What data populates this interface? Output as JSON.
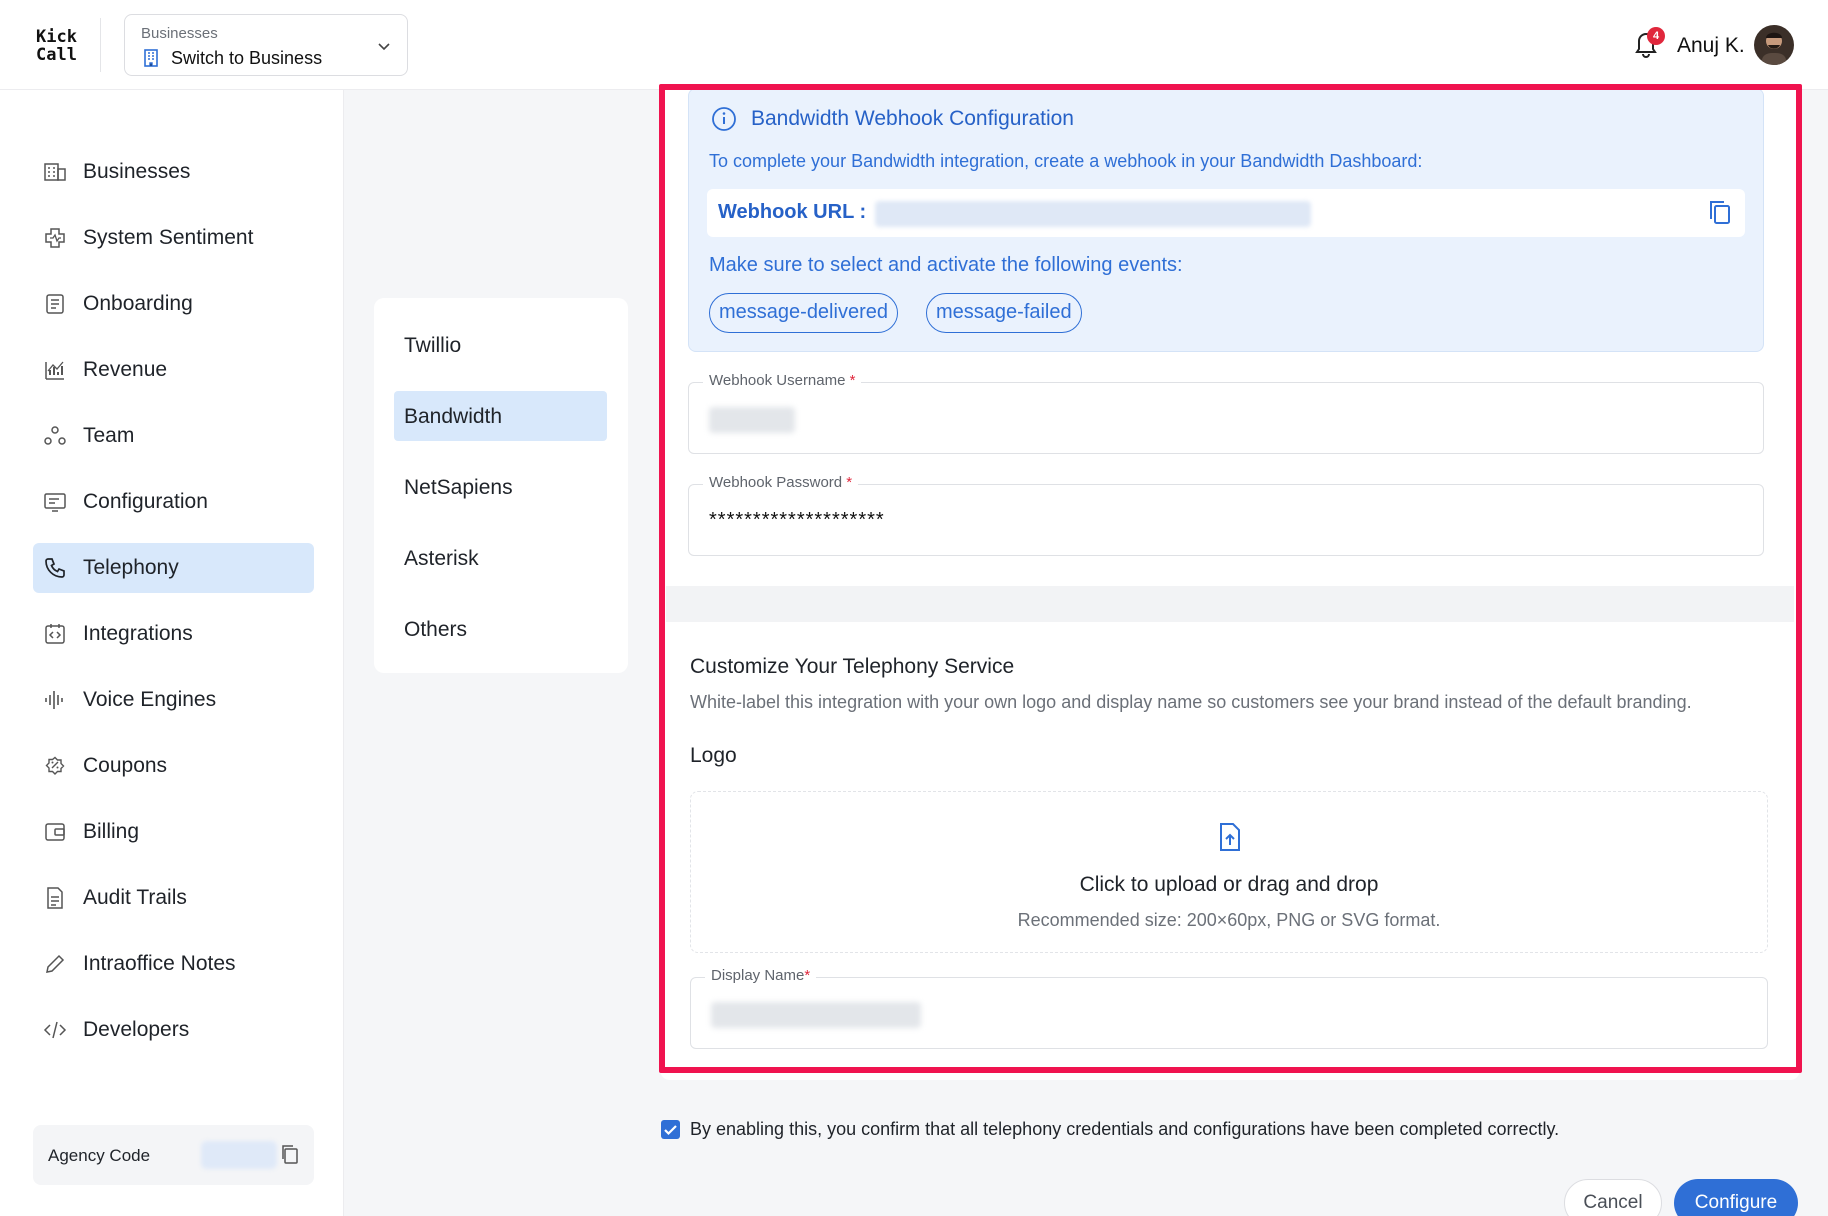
{
  "header": {
    "logo_line1": "Kick",
    "logo_line2": "Call",
    "business_caption": "Businesses",
    "business_value": "Switch to Business",
    "notification_count": "4",
    "user_name": "Anuj K."
  },
  "sidebar": {
    "items": [
      {
        "label": "Businesses",
        "icon": "building-icon"
      },
      {
        "label": "System Sentiment",
        "icon": "sentiment-icon"
      },
      {
        "label": "Onboarding",
        "icon": "document-icon"
      },
      {
        "label": "Revenue",
        "icon": "chart-icon"
      },
      {
        "label": "Team",
        "icon": "team-icon"
      },
      {
        "label": "Configuration",
        "icon": "configuration-icon"
      },
      {
        "label": "Telephony",
        "icon": "phone-icon",
        "active": true
      },
      {
        "label": "Integrations",
        "icon": "integrations-icon"
      },
      {
        "label": "Voice Engines",
        "icon": "waveform-icon"
      },
      {
        "label": "Coupons",
        "icon": "coupon-icon"
      },
      {
        "label": "Billing",
        "icon": "wallet-icon"
      },
      {
        "label": "Audit Trails",
        "icon": "file-icon"
      },
      {
        "label": "Intraoffice Notes",
        "icon": "pencil-icon"
      },
      {
        "label": "Developers",
        "icon": "code-icon"
      }
    ],
    "agency_code_label": "Agency Code"
  },
  "providers": {
    "items": [
      "Twillio",
      "Bandwidth",
      "NetSapiens",
      "Asterisk",
      "Others"
    ],
    "active": "Bandwidth"
  },
  "webhook": {
    "title": "Bandwidth Webhook Configuration",
    "description": "To complete your Bandwidth integration, create a webhook in your Bandwidth Dashboard:",
    "url_label": "Webhook URL :",
    "events_label": "Make sure to select and activate the following events:",
    "events": [
      "message-delivered",
      "message-failed"
    ]
  },
  "form": {
    "username_label": "Webhook Username",
    "password_label": "Webhook Password",
    "password_value": "********************",
    "required_mark": "*"
  },
  "customize": {
    "title": "Customize Your Telephony Service",
    "description": "White-label this integration with your own logo and display name so customers see your brand instead of the default branding.",
    "logo_label": "Logo",
    "upload_text": "Click to upload or drag and drop",
    "upload_hint": "Recommended size: 200×60px, PNG or SVG format.",
    "display_name_label": "Display Name"
  },
  "confirm": {
    "checked": true,
    "text": "By enabling this, you confirm that all telephony credentials and configurations have been completed correctly."
  },
  "actions": {
    "cancel": "Cancel",
    "configure": "Configure"
  },
  "colors": {
    "accent": "#2f6fd6",
    "highlight": "#f0134f",
    "active_bg": "#d8e8fb",
    "required": "#e0273c"
  }
}
